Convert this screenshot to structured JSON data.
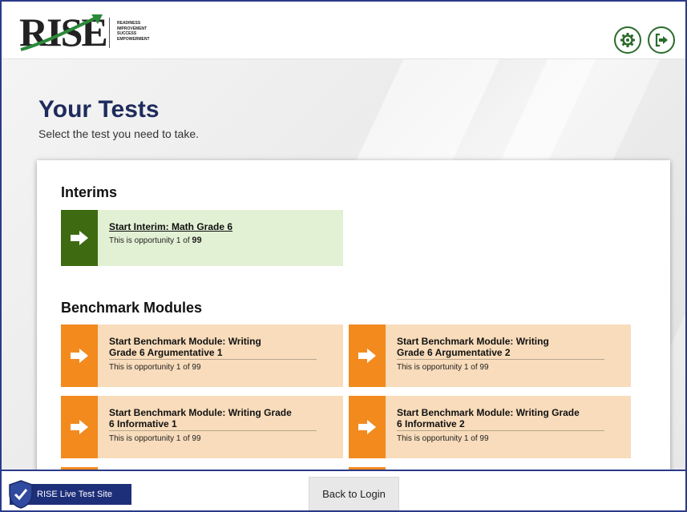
{
  "header": {
    "logo_text": "RISE",
    "logo_tagline": [
      "READINESS",
      "IMPROVEMENT",
      "SUCCESS",
      "EMPOWERMENT"
    ],
    "settings_icon": "gear-icon",
    "logout_icon": "logout-icon"
  },
  "page": {
    "title": "Your Tests",
    "subtitle": "Select the test you need to take."
  },
  "interims": {
    "heading": "Interims",
    "tests": [
      {
        "title": "Start Interim: Math Grade 6",
        "opportunity_prefix": "This is opportunity 1 of",
        "opportunity_max": "99"
      }
    ]
  },
  "benchmark": {
    "heading": "Benchmark Modules",
    "tests": [
      {
        "title_line1": "Start Benchmark Module: Writing",
        "title_line2": "Grade 6 Argumentative 1",
        "opportunity": "This is opportunity 1 of 99"
      },
      {
        "title_line1": "Start Benchmark Module: Writing",
        "title_line2": "Grade 6 Argumentative 2",
        "opportunity": "This is opportunity 1 of 99"
      },
      {
        "title_line1": "Start Benchmark Module: Writing Grade",
        "title_line2": "6  Informative 1",
        "opportunity": "This is opportunity 1 of 99"
      },
      {
        "title_line1": "Start Benchmark Module: Writing Grade",
        "title_line2": "6  Informative 2",
        "opportunity": "This is opportunity 1 of 99"
      }
    ]
  },
  "footer": {
    "site_label": "RISE Live Test Site",
    "back_button": "Back to Login"
  },
  "colors": {
    "navy": "#1e2b5c",
    "interim_arrow": "#3e6b12",
    "interim_bg": "#e2f0d4",
    "benchmark_arrow": "#f28a1e",
    "benchmark_bg": "#f8dcbb"
  }
}
